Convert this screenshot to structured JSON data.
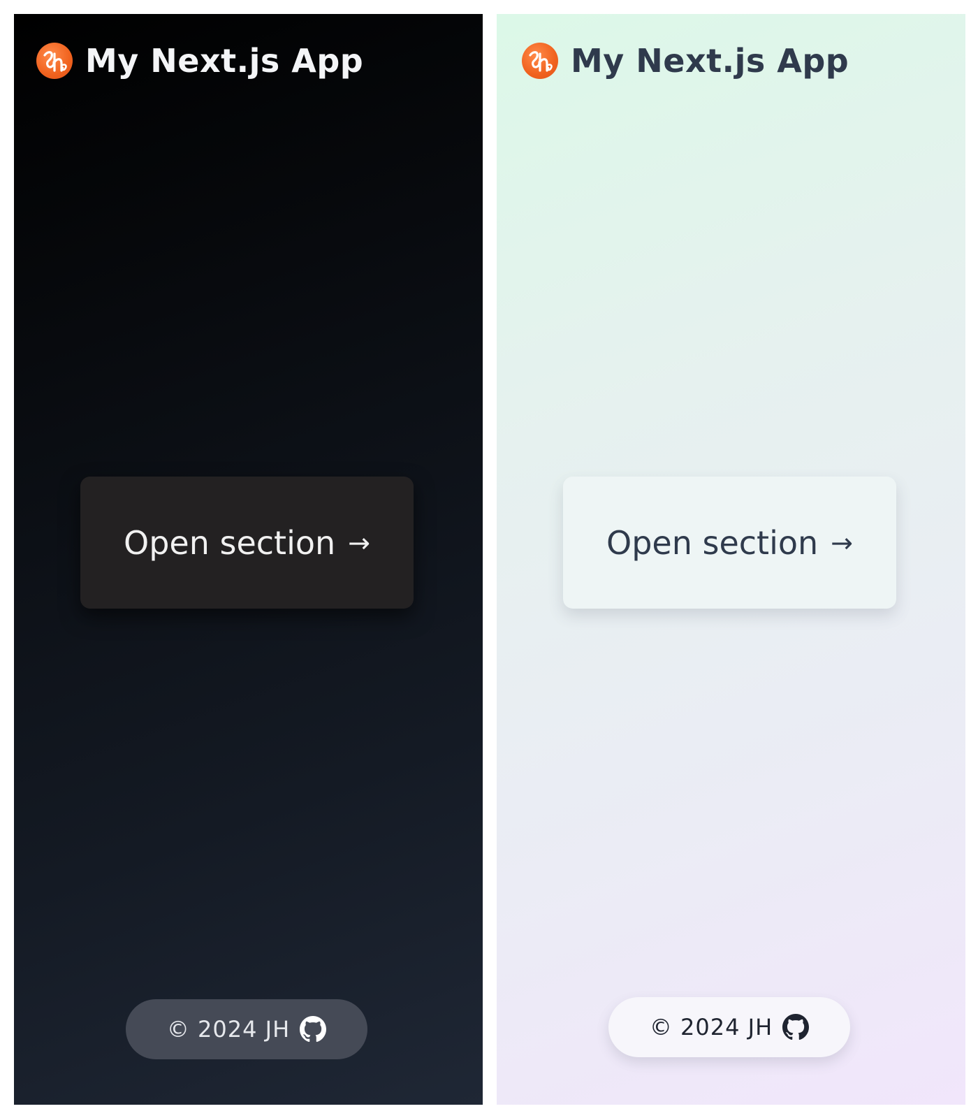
{
  "colors": {
    "dark_bg_start": "#000000",
    "dark_bg_end": "#1f2735",
    "light_bg_start": "#dcf8e8",
    "light_bg_end": "#f1e6fb",
    "logo_orange": "#f0621e",
    "dark_title": "#f4f5f7",
    "light_title": "#2f3a4c"
  },
  "dark": {
    "header": {
      "title": "My Next.js App",
      "logo_icon": "jh-logo-icon"
    },
    "main": {
      "open_label": "Open section",
      "arrow": "→"
    },
    "footer": {
      "copyright": "© 2024 JH",
      "github_icon": "github-icon"
    }
  },
  "light": {
    "header": {
      "title": "My Next.js App",
      "logo_icon": "jh-logo-icon"
    },
    "main": {
      "open_label": "Open section",
      "arrow": "→"
    },
    "footer": {
      "copyright": "© 2024 JH",
      "github_icon": "github-icon"
    }
  }
}
